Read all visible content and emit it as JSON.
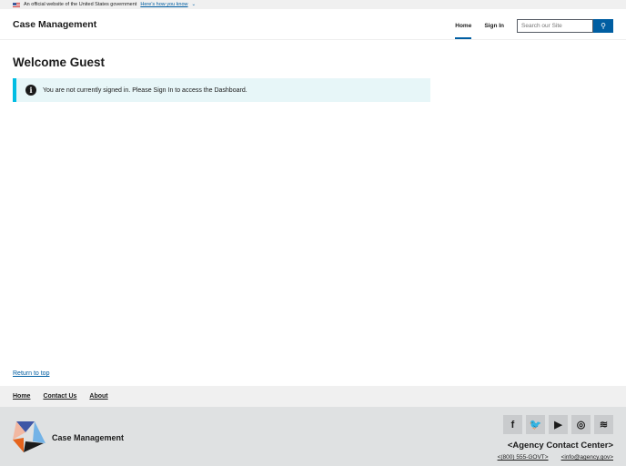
{
  "banner": {
    "text": "An official website of the United States government",
    "link": "Here’s how you know"
  },
  "header": {
    "title": "Case Management",
    "nav": [
      "Home",
      "Sign In"
    ],
    "search_placeholder": "Search our Site"
  },
  "main": {
    "heading": "Welcome Guest",
    "alert": "You are not currently signed in. Please Sign In to access the Dashboard."
  },
  "return_to_top": "Return to top",
  "footer": {
    "nav": [
      "Home",
      "Contact Us",
      "About"
    ],
    "title": "Case Management",
    "contact_center": "<Agency Contact Center>",
    "phone": "<(800) 555-GOVT>",
    "email": "<info@agency.gov>"
  }
}
